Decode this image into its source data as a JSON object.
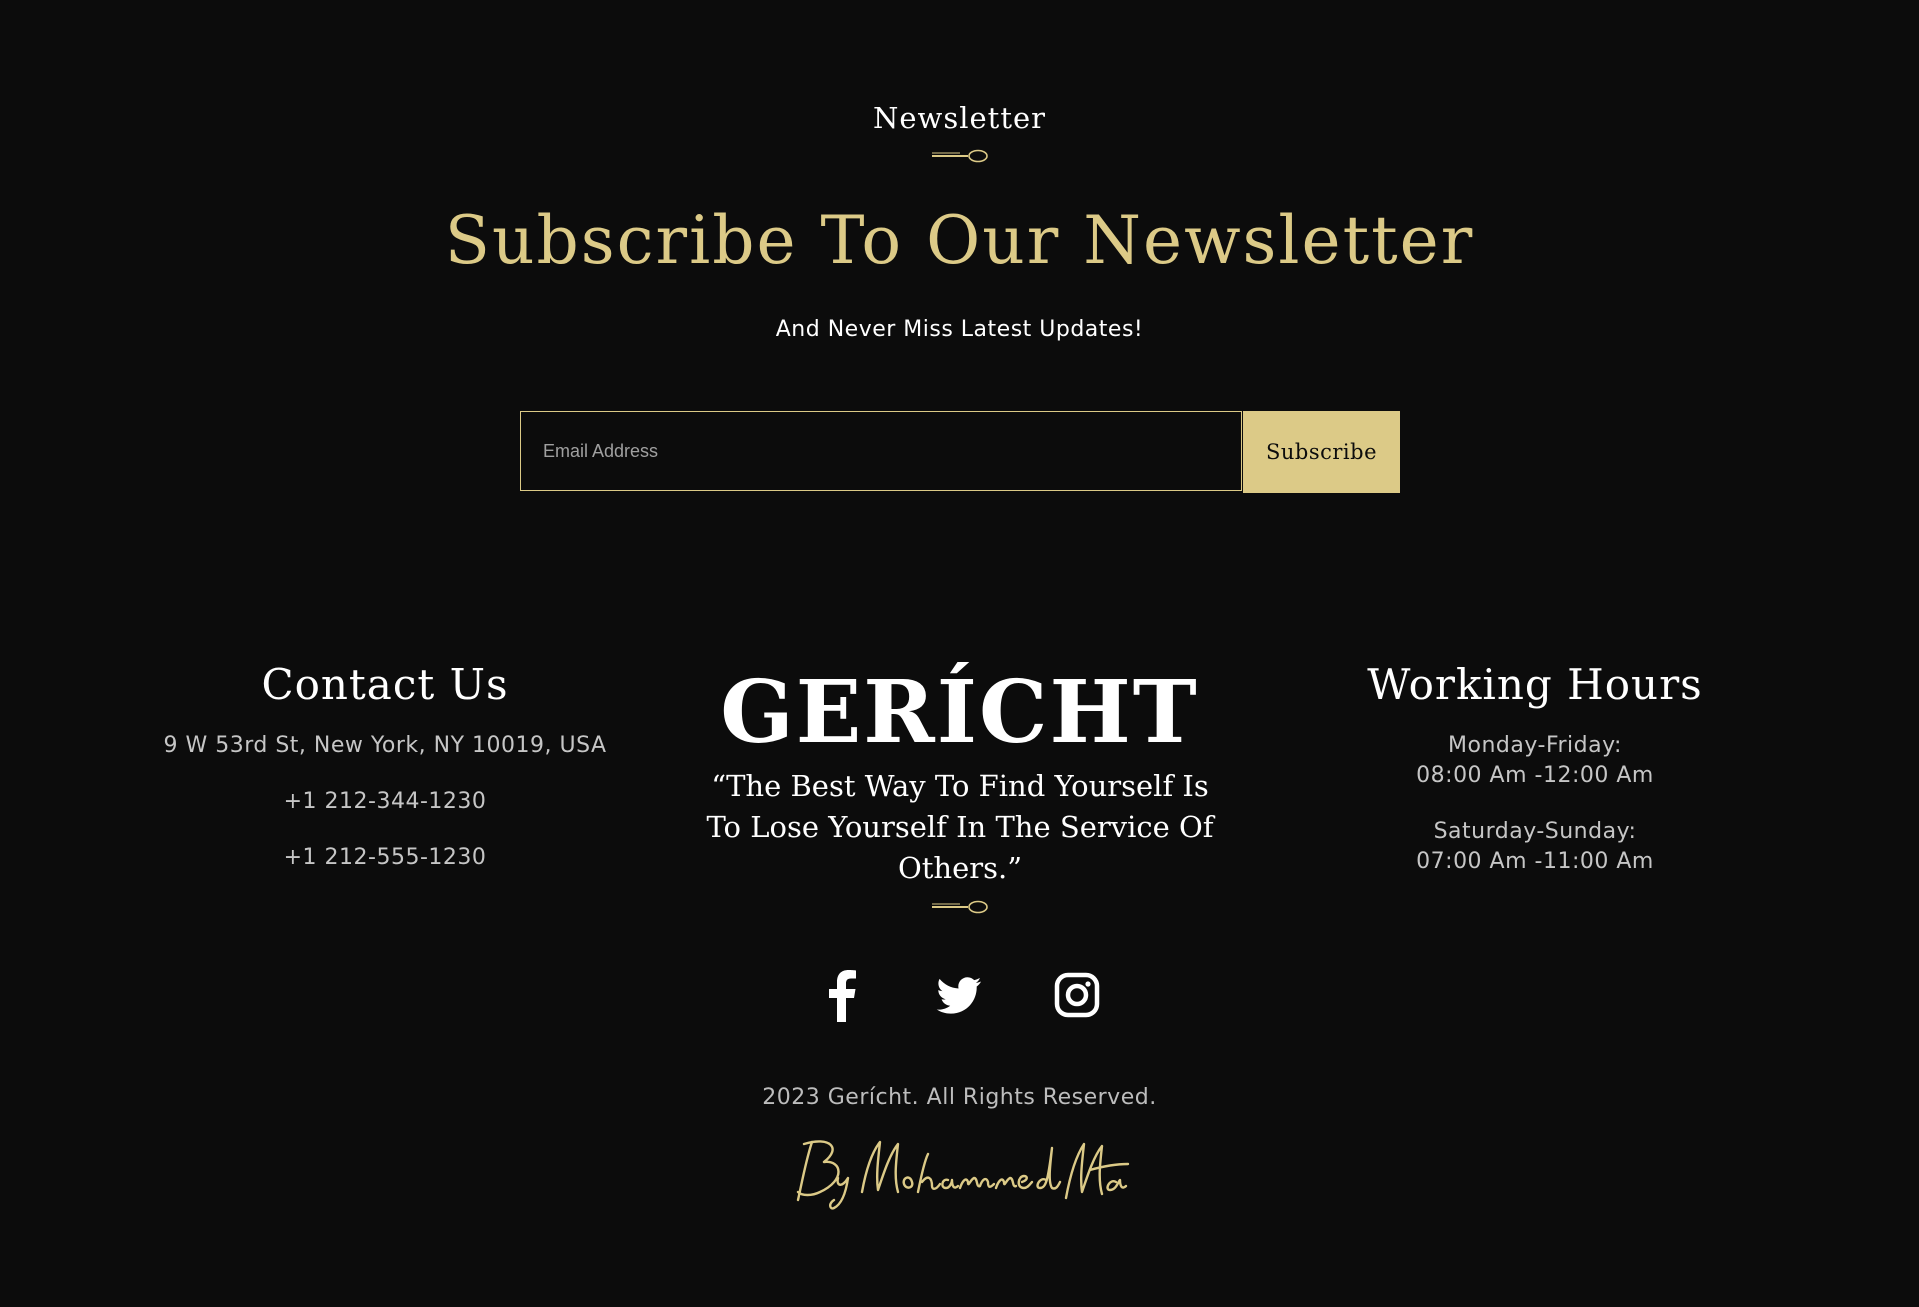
{
  "newsletter": {
    "eyebrow": "Newsletter",
    "headline": "Subscribe To Our Newsletter",
    "subline": "And Never Miss Latest Updates!",
    "email_placeholder": "Email Address",
    "subscribe_label": "Subscribe"
  },
  "contact": {
    "title": "Contact Us",
    "address": "9 W 53rd St, New York, NY 10019, USA",
    "phone_1": "+1 212-344-1230",
    "phone_2": "+1 212-555-1230"
  },
  "brand": {
    "name": "GERÍCHT",
    "quote": "“The Best Way To Find Yourself Is To Lose Yourself In The Service Of Others.”"
  },
  "hours": {
    "title": "Working Hours",
    "weekday_label": "Monday-Friday:",
    "weekday_time": "08:00 Am -12:00 Am",
    "weekend_label": "Saturday-Sunday:",
    "weekend_time": "07:00 Am -11:00 Am"
  },
  "social": {
    "icons": [
      "facebook-icon",
      "twitter-icon",
      "instagram-icon"
    ]
  },
  "footer": {
    "copyright": "2023 Gerícht. All Rights Reserved.",
    "signature": "By Mohammed Matar"
  },
  "colors": {
    "background": "#0c0c0c",
    "gold": "#dcca87",
    "text": "#ffffff",
    "muted": "#c6c6c6"
  }
}
